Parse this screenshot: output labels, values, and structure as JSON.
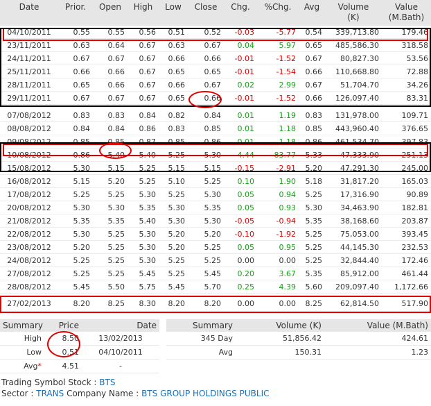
{
  "headers": [
    "Date",
    "Prior.",
    "Open",
    "High",
    "Low",
    "Close",
    "Chg.",
    "%Chg.",
    "Avg",
    "Volume\n(K)",
    "Value\n(M.Bath)"
  ],
  "rows": [
    [
      "04/10/2011",
      "0.55",
      "0.55",
      "0.56",
      "0.51",
      "0.52",
      "-0.03",
      "-5.77",
      "0.54",
      "339,713.80",
      "179.46"
    ],
    [
      "23/11/2011",
      "0.63",
      "0.64",
      "0.67",
      "0.63",
      "0.67",
      "0.04",
      "5.97",
      "0.65",
      "485,586.30",
      "318.58"
    ],
    [
      "24/11/2011",
      "0.67",
      "0.67",
      "0.67",
      "0.66",
      "0.66",
      "-0.01",
      "-1.52",
      "0.67",
      "80,827.30",
      "53.56"
    ],
    [
      "25/11/2011",
      "0.66",
      "0.66",
      "0.67",
      "0.65",
      "0.65",
      "-0.01",
      "-1.54",
      "0.66",
      "110,668.80",
      "72.88"
    ],
    [
      "28/11/2011",
      "0.65",
      "0.66",
      "0.67",
      "0.66",
      "0.67",
      "0.02",
      "2.99",
      "0.67",
      "51,704.70",
      "34.26"
    ],
    [
      "29/11/2011",
      "0.67",
      "0.67",
      "0.67",
      "0.65",
      "0.66",
      "-0.01",
      "-1.52",
      "0.66",
      "126,097.40",
      "83.31"
    ],
    [
      "07/08/2012",
      "0.83",
      "0.83",
      "0.84",
      "0.82",
      "0.84",
      "0.01",
      "1.19",
      "0.83",
      "131,978.00",
      "109.71"
    ],
    [
      "08/08/2012",
      "0.84",
      "0.84",
      "0.86",
      "0.83",
      "0.85",
      "0.01",
      "1.18",
      "0.85",
      "443,960.40",
      "376.65"
    ],
    [
      "09/08/2012",
      "0.85",
      "0.85",
      "0.87",
      "0.85",
      "0.86",
      "0.01",
      "1.18",
      "0.86",
      "461,534.70",
      "397.83"
    ],
    [
      "10/08/2012",
      "0.86",
      "5.40",
      "5.40",
      "5.25",
      "5.30",
      "4.44",
      "83.77",
      "5.33",
      "47,333.90",
      "251.13"
    ],
    [
      "15/08/2012",
      "5.30",
      "5.15",
      "5.25",
      "5.15",
      "5.15",
      "-0.15",
      "-2.91",
      "5.20",
      "47,291.30",
      "245.00"
    ],
    [
      "16/08/2012",
      "5.15",
      "5.20",
      "5.25",
      "5.10",
      "5.25",
      "0.10",
      "1.90",
      "5.18",
      "31,817.20",
      "165.03"
    ],
    [
      "17/08/2012",
      "5.25",
      "5.25",
      "5.30",
      "5.25",
      "5.30",
      "0.05",
      "0.94",
      "5.25",
      "17,316.90",
      "90.89"
    ],
    [
      "20/08/2012",
      "5.30",
      "5.30",
      "5.35",
      "5.30",
      "5.35",
      "0.05",
      "0.93",
      "5.30",
      "34,463.90",
      "182.81"
    ],
    [
      "21/08/2012",
      "5.35",
      "5.35",
      "5.40",
      "5.30",
      "5.30",
      "-0.05",
      "-0.94",
      "5.35",
      "38,168.60",
      "203.87"
    ],
    [
      "22/08/2012",
      "5.30",
      "5.25",
      "5.30",
      "5.20",
      "5.20",
      "-0.10",
      "-1.92",
      "5.25",
      "75,053.00",
      "393.45"
    ],
    [
      "23/08/2012",
      "5.20",
      "5.25",
      "5.30",
      "5.20",
      "5.25",
      "0.05",
      "0.95",
      "5.25",
      "44,145.30",
      "232.53"
    ],
    [
      "24/08/2012",
      "5.25",
      "5.25",
      "5.30",
      "5.25",
      "5.25",
      "0.00",
      "0.00",
      "5.25",
      "32,844.40",
      "172.46"
    ],
    [
      "27/08/2012",
      "5.25",
      "5.25",
      "5.45",
      "5.25",
      "5.45",
      "0.20",
      "3.67",
      "5.35",
      "85,912.00",
      "461.44"
    ],
    [
      "28/08/2012",
      "5.45",
      "5.50",
      "5.75",
      "5.45",
      "5.70",
      "0.25",
      "4.39",
      "5.60",
      "209,097.40",
      "1,172.66"
    ]
  ],
  "last_row": [
    "27/02/2013",
    "8.20",
    "8.25",
    "8.30",
    "8.20",
    "8.20",
    "0.00",
    "0.00",
    "8.25",
    "62,814.50",
    "517.90"
  ],
  "summary_price": {
    "headers": [
      "Summary",
      "Price",
      "Date"
    ],
    "rows": [
      {
        "label": "High",
        "price": "8.50",
        "date": "13/02/2013"
      },
      {
        "label": "Low",
        "price": "0.51",
        "date": "04/10/2011"
      },
      {
        "label": "Avg",
        "price": "4.51",
        "date": "-",
        "star": "*"
      }
    ]
  },
  "summary_volume": {
    "headers": [
      "Summary",
      "Volume (K)",
      "Value (M.Bath)"
    ],
    "rows": [
      {
        "label": "345 Day",
        "volume": "51,856.42",
        "value": "424.61"
      },
      {
        "label": "Avg",
        "volume": "150.31",
        "value": "1.23"
      }
    ]
  },
  "info": {
    "symbol_label": "Trading Symbol Stock :",
    "symbol": "BTS",
    "sector_label": "Sector :",
    "sector": "TRANS",
    "company_label": "Company Name :",
    "company": "BTS GROUP HOLDINGS PUBLIC"
  },
  "colors": {
    "up": "#16a016",
    "down": "#e00000",
    "link": "#1a6fb0",
    "header_bg": "#e6e6e6",
    "highlight": "#e00000"
  }
}
